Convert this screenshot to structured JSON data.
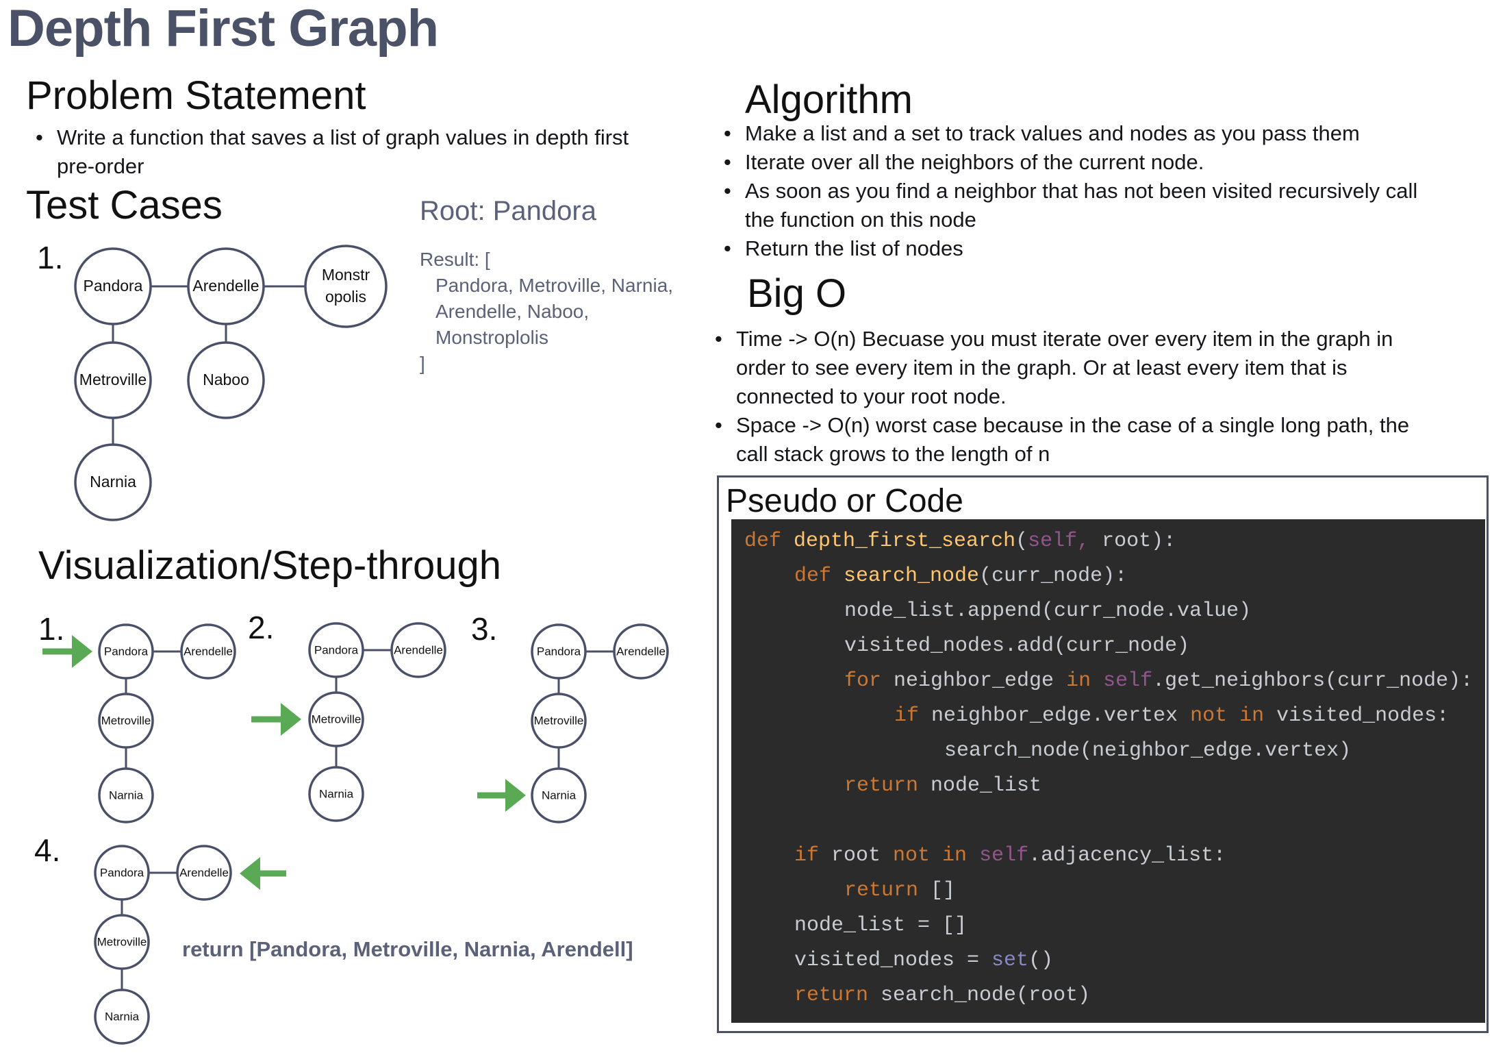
{
  "title": "Depth First Graph",
  "problem": {
    "heading": "Problem Statement",
    "bullets": [
      "Write a function that saves a list of graph values in depth first pre-order"
    ]
  },
  "test_cases": {
    "heading": "Test Cases",
    "number": "1.",
    "nodes": {
      "pandora": "Pandora",
      "arendelle": "Arendelle",
      "monstro_1": "Monstr",
      "monstro_2": "opolis",
      "metroville": "Metroville",
      "naboo": "Naboo",
      "narnia": "Narnia"
    },
    "root_label": "Root: Pandora",
    "result_open": "Result: [",
    "result_lines": [
      "Pandora, Metroville, Narnia,",
      "Arendelle, Naboo,",
      "Monstroplolis"
    ],
    "result_close": "]"
  },
  "visualization": {
    "heading": "Visualization/Step-through",
    "steps": [
      {
        "number": "1.",
        "arrow": "right",
        "highlight": "Pandora"
      },
      {
        "number": "2.",
        "arrow": "right",
        "highlight": "Metroville"
      },
      {
        "number": "3.",
        "arrow": "right",
        "highlight": "Narnia"
      },
      {
        "number": "4.",
        "arrow": "left",
        "highlight": "Arendelle"
      }
    ],
    "node_labels": [
      "Pandora",
      "Arendelle",
      "Metroville",
      "Narnia"
    ],
    "return_text": "return [Pandora, Metroville, Narnia, Arendell]",
    "arrow_color": "#5aaa55"
  },
  "algorithm": {
    "heading": "Algorithm",
    "bullets": [
      "Make a list and a set to track values and nodes as you pass them",
      "Iterate over all the neighbors of the current node.",
      "As soon as you find a neighbor that has not been visited recursively call the function on this node",
      "Return the list of nodes"
    ]
  },
  "big_o": {
    "heading": "Big O",
    "bullets": [
      "Time -> O(n) Becuase you must iterate over every item in the graph in order to see every item in the graph. Or at least every item that is connected to your root node.",
      "Space -> O(n) worst case because in the case of a single long path, the call stack grows to the length of n"
    ]
  },
  "code": {
    "heading": "Pseudo or Code",
    "lines": [
      {
        "indent": 0,
        "tokens": [
          [
            "kw",
            "def "
          ],
          [
            "fn",
            "depth_first_search"
          ],
          [
            "tx",
            "("
          ],
          [
            "sf",
            "self, "
          ],
          [
            "tx",
            "root):"
          ]
        ]
      },
      {
        "indent": 1,
        "tokens": [
          [
            "kw",
            "def "
          ],
          [
            "fn",
            "search_node"
          ],
          [
            "tx",
            "(curr_node):"
          ]
        ]
      },
      {
        "indent": 2,
        "tokens": [
          [
            "tx",
            "node_list.append(curr_node.value)"
          ]
        ]
      },
      {
        "indent": 2,
        "tokens": [
          [
            "tx",
            "visited_nodes.add(curr_node)"
          ]
        ]
      },
      {
        "indent": 2,
        "tokens": [
          [
            "kw",
            "for "
          ],
          [
            "tx",
            "neighbor_edge "
          ],
          [
            "kw",
            "in "
          ],
          [
            "sf",
            "self"
          ],
          [
            "tx",
            ".get_neighbors(curr_node):"
          ]
        ]
      },
      {
        "indent": 3,
        "tokens": [
          [
            "kw",
            "if "
          ],
          [
            "tx",
            "neighbor_edge.vertex "
          ],
          [
            "kw",
            "not in "
          ],
          [
            "tx",
            "visited_nodes:"
          ]
        ]
      },
      {
        "indent": 4,
        "tokens": [
          [
            "tx",
            "search_node(neighbor_edge.vertex)"
          ]
        ]
      },
      {
        "indent": 2,
        "tokens": [
          [
            "kw",
            "return "
          ],
          [
            "tx",
            "node_list"
          ]
        ]
      },
      {
        "indent": 0,
        "tokens": []
      },
      {
        "indent": 1,
        "tokens": [
          [
            "kw",
            "if "
          ],
          [
            "tx",
            "root "
          ],
          [
            "kw",
            "not in "
          ],
          [
            "sf",
            "self"
          ],
          [
            "tx",
            ".adjacency_list:"
          ]
        ]
      },
      {
        "indent": 2,
        "tokens": [
          [
            "kw",
            "return "
          ],
          [
            "tx",
            "[]"
          ]
        ]
      },
      {
        "indent": 1,
        "tokens": [
          [
            "tx",
            "node_list = []"
          ]
        ]
      },
      {
        "indent": 1,
        "tokens": [
          [
            "tx",
            "visited_nodes = "
          ],
          [
            "bi",
            "set"
          ],
          [
            "tx",
            "()"
          ]
        ]
      },
      {
        "indent": 1,
        "tokens": [
          [
            "kw",
            "return "
          ],
          [
            "tx",
            "search_node(root)"
          ]
        ]
      }
    ]
  }
}
